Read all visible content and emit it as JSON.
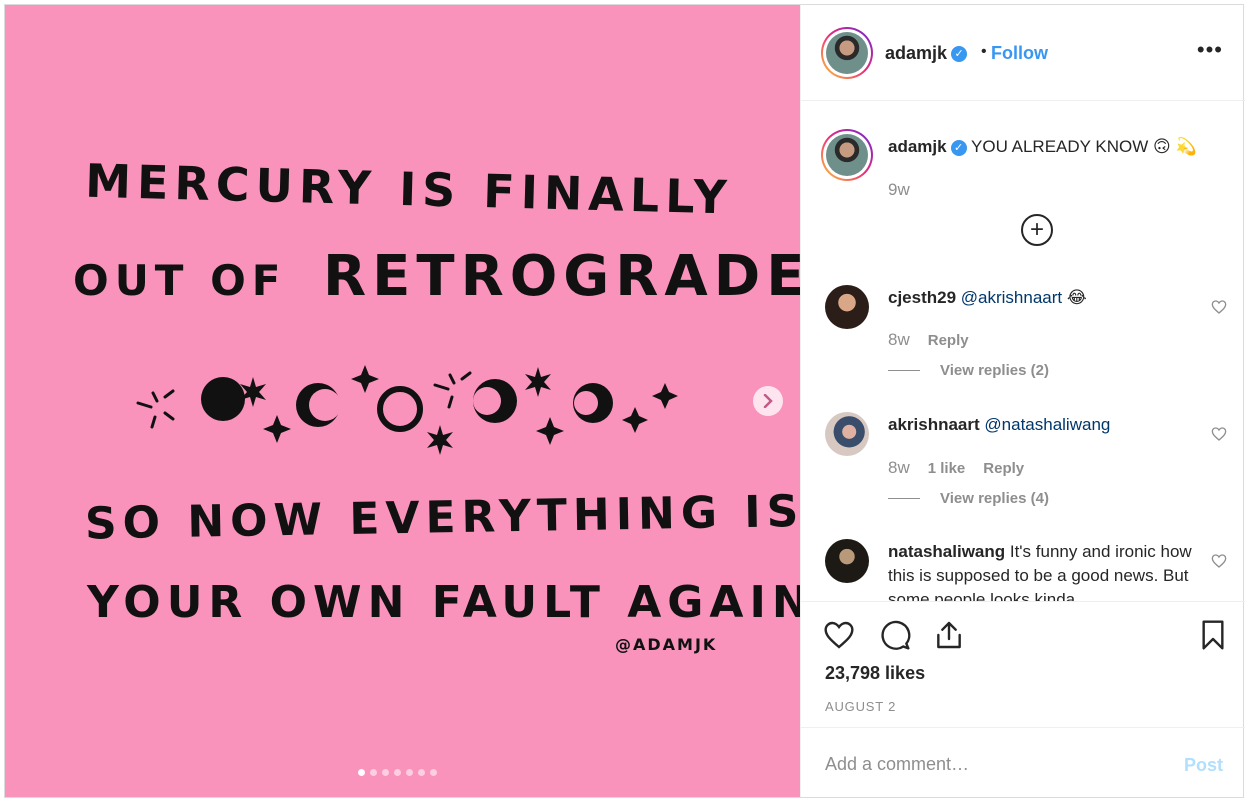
{
  "post": {
    "image_text": {
      "line1": "MERCURY IS FINALLY",
      "line2_a": "OUT OF",
      "line2_b": "RETROGRADE",
      "line3": "SO NOW EVERYTHING IS",
      "line4": "YOUR OWN FAULT AGAIN",
      "signature": "@ADAMJK"
    },
    "background_color": "#f993bb",
    "carousel_dots": 7,
    "active_dot": 0
  },
  "header": {
    "username": "adamjk",
    "verified_icon": "✓",
    "separator": "•",
    "follow_label": "Follow",
    "more_icon": "•••"
  },
  "caption": {
    "username": "adamjk",
    "text": " YOU ALREADY KNOW 🙃 💫",
    "time": "9w"
  },
  "comments": [
    {
      "username": "cjesth29",
      "mention": "@akrishnaart",
      "text": " 😂",
      "time": "8w",
      "likes": "",
      "reply": "Reply",
      "view_replies": "View replies (2)"
    },
    {
      "username": "akrishnaart",
      "mention": "@natashaliwang",
      "text": "",
      "time": "8w",
      "likes": "1 like",
      "reply": "Reply",
      "view_replies": "View replies (4)"
    },
    {
      "username": "natashaliwang",
      "mention": "",
      "text": " It's funny and ironic how this is supposed to be a good news. But some people looks kinda"
    }
  ],
  "likes": "23,798 likes",
  "date": "AUGUST 2",
  "add_comment": {
    "placeholder": "Add a comment…",
    "post_label": "Post"
  },
  "colors": {
    "accent": "#3897f0",
    "mention": "#00376b",
    "muted": "#8e8e8e"
  }
}
